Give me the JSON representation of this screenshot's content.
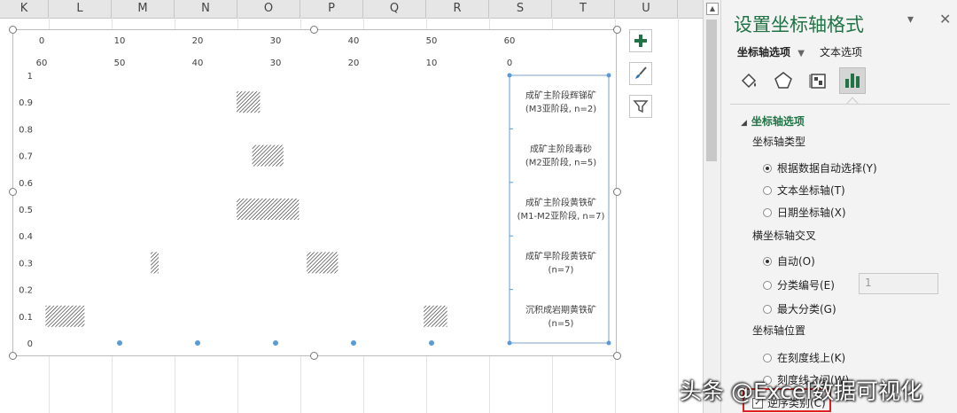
{
  "columns": [
    "K",
    "L",
    "M",
    "N",
    "O",
    "P",
    "Q",
    "R",
    "S",
    "T",
    "U"
  ],
  "chart_data": {
    "type": "bar",
    "top_axis_labels": [
      "0",
      "10",
      "20",
      "30",
      "40",
      "50",
      "60"
    ],
    "top_axis_reversed_labels": [
      "60",
      "50",
      "40",
      "30",
      "20",
      "10",
      "0"
    ],
    "y_tick_labels": [
      "1",
      "0.9",
      "0.8",
      "0.7",
      "0.6",
      "0.5",
      "0.4",
      "0.3",
      "0.2",
      "0.1",
      "0"
    ],
    "ylim": [
      0,
      1
    ],
    "xlim": [
      0,
      60
    ],
    "category_labels": [
      {
        "line1": "成矿主阶段辉锑矿",
        "line2": "(M3亚阶段, n=2)",
        "y": 0.9
      },
      {
        "line1": "成矿主阶段毒砂",
        "line2": "(M2亚阶段, n=5)",
        "y": 0.7
      },
      {
        "line1": "成矿主阶段黄铁矿",
        "line2": "(M1-M2亚阶段, n=7)",
        "y": 0.5
      },
      {
        "line1": "成矿早阶段黄铁矿",
        "line2": "(n=7)",
        "y": 0.3
      },
      {
        "line1": "沉积成岩期黄铁矿",
        "line2": "(n=5)",
        "y": 0.1
      }
    ],
    "ranges": [
      {
        "x0": 25,
        "x1": 28,
        "y": 0.9
      },
      {
        "x0": 27,
        "x1": 31,
        "y": 0.7
      },
      {
        "x0": 25,
        "x1": 33,
        "y": 0.5
      },
      {
        "x0": 14,
        "x1": 15,
        "y": 0.3
      },
      {
        "x0": 34,
        "x1": 38,
        "y": 0.3
      },
      {
        "x0": 0.5,
        "x1": 5.5,
        "y": 0.1
      },
      {
        "x0": 49,
        "x1": 52,
        "y": 0.1
      }
    ],
    "bottom_points_x": [
      10,
      20,
      30,
      40,
      50
    ]
  },
  "chart_buttons": {
    "add_element": "chart-elements",
    "style": "chart-styles",
    "filter": "chart-filters"
  },
  "pane": {
    "title": "设置坐标轴格式",
    "tab_axis_options": "坐标轴选项",
    "tab_text_options": "文本选项",
    "section_axis_options": "坐标轴选项",
    "axis_type_label": "坐标轴类型",
    "axis_type_options": [
      "根据数据自动选择(Y)",
      "文本坐标轴(T)",
      "日期坐标轴(X)"
    ],
    "axis_type_selected": 0,
    "cross_label": "横坐标轴交叉",
    "cross_options": [
      "自动(O)",
      "分类编号(E)",
      "最大分类(G)"
    ],
    "cross_selected": 0,
    "category_number_value": "1",
    "axis_position_label": "坐标轴位置",
    "axis_position_options": [
      "在刻度线上(K)",
      "刻度线之间(W)"
    ],
    "reverse_order_label": "逆序类别(C)"
  },
  "watermark": "头条 @Excel数据可视化",
  "colors": {
    "accent_green": "#217346",
    "highlight_red": "#e0201f",
    "handle_blue": "#5b9bd5"
  }
}
